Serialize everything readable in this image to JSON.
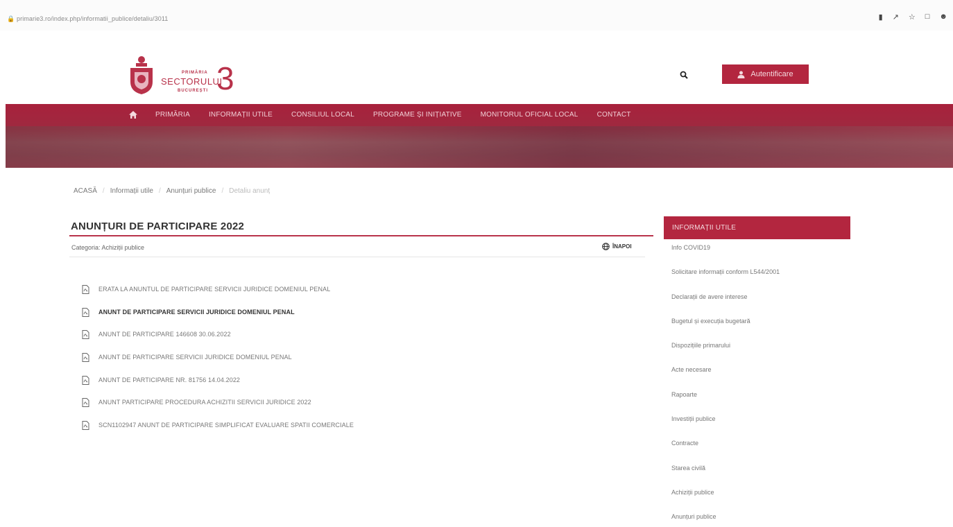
{
  "browser": {
    "url": "primarie3.ro/index.php/informatii_publice/detaliu/3011"
  },
  "header": {
    "logo_line1": "PRIMĂRIA",
    "logo_line2": "SECTORULUI",
    "logo_line3": "BUCUREȘTI",
    "logo_number": "3",
    "auth_button": "Autentificare"
  },
  "nav": {
    "items": [
      "PRIMĂRIA",
      "INFORMAȚII UTILE",
      "CONSILIUL LOCAL",
      "PROGRAME ȘI INIȚIATIVE",
      "MONITORUL OFICIAL LOCAL",
      "CONTACT"
    ]
  },
  "breadcrumb": {
    "items": [
      "ACASĂ",
      "Informații utile",
      "Anunțuri publice"
    ],
    "current": "Detaliu anunț"
  },
  "main": {
    "title": "ANUNȚURI DE PARTICIPARE 2022",
    "category": "Categoria: Achiziții publice",
    "back_label": "ÎNAPOI",
    "documents": [
      "ERATA LA ANUNTUL DE PARTICIPARE SERVICII JURIDICE DOMENIUL PENAL",
      "ANUNT DE PARTICIPARE SERVICII JURIDICE DOMENIUL PENAL",
      "ANUNT DE PARTICIPARE 146608 30.06.2022",
      "ANUNT DE PARTICIPARE SERVICII JURIDICE DOMENIUL PENAL",
      "ANUNT DE PARTICIPARE NR. 81756 14.04.2022",
      "ANUNT PARTICIPARE PROCEDURA ACHIZITII SERVICII JURIDICE 2022",
      "SCN1102947 ANUNT DE PARTICIPARE SIMPLIFICAT EVALUARE SPATII COMERCIALE"
    ]
  },
  "sidebar": {
    "header": "INFORMAȚII UTILE",
    "items": [
      "Info COVID19",
      "Solicitare informații conform L544/2001",
      "Declarații de avere interese",
      "Bugetul și execuția bugetară",
      "Dispozițiile primarului",
      "Acte necesare",
      "Rapoarte",
      "Investiții publice",
      "Contracte",
      "Starea civilă",
      "Achiziții publice",
      "Anunțuri publice"
    ]
  },
  "colors": {
    "accent": "#b3263f"
  }
}
